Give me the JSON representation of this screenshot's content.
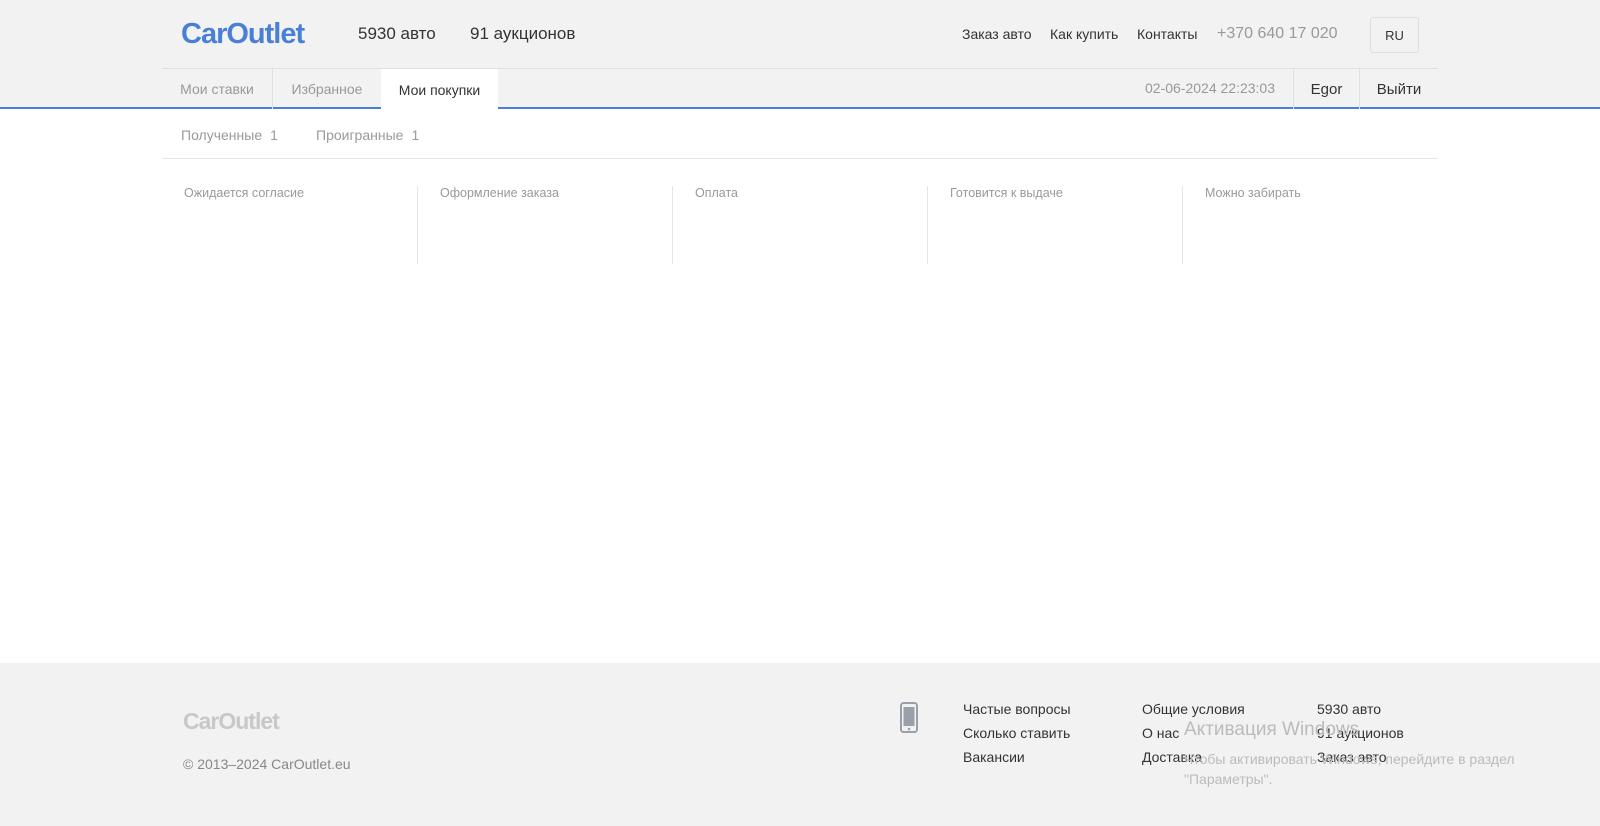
{
  "header": {
    "logo": "CarOutlet",
    "cars_count": "5930 авто",
    "auctions_count": "91 аукционов",
    "nav": {
      "order": "Заказ авто",
      "how_to_buy": "Как купить",
      "contacts": "Контакты"
    },
    "phone": "+370 640 17 020",
    "language": "RU"
  },
  "tabs": {
    "my_bids": "Мои ставки",
    "favorites": "Избранное",
    "my_purchases": "Мои покупки",
    "active": "my_purchases"
  },
  "session": {
    "datetime": "02-06-2024 22:23:03",
    "user": "Egor",
    "logout": "Выйти"
  },
  "subtabs": {
    "received": {
      "label": "Полученные",
      "count": "1"
    },
    "lost": {
      "label": "Проигранные",
      "count": "1"
    }
  },
  "statuses": [
    "Ожидается согласие",
    "Оформление заказа",
    "Оплата",
    "Готовится к выдаче",
    "Можно забирать"
  ],
  "footer": {
    "logo": "CarOutlet",
    "copyright": "© 2013–2024 CarOutlet.eu",
    "icon": "mobile-phone-icon",
    "links_col1": [
      "Частые вопросы",
      "Сколько ставить",
      "Вакансии"
    ],
    "links_col2": [
      "Общие условия",
      "О нас",
      "Доставка"
    ],
    "links_col3": [
      "5930 авто",
      "91 аукционов",
      "Заказ авто"
    ]
  },
  "os_overlay": {
    "title": "Активация Windows",
    "text": "Чтобы активировать Windows, перейдите в раздел \"Параметры\"."
  },
  "colors": {
    "brand": "#4a7fd8",
    "header_bg": "#f2f2f2",
    "muted_text": "#999999"
  }
}
